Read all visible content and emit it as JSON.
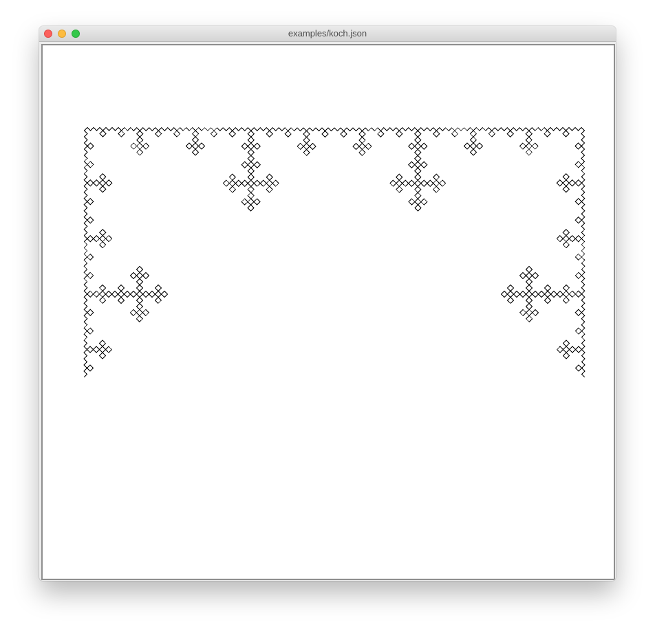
{
  "window": {
    "title": "examples/koch.json",
    "buttons": {
      "close": "close-button",
      "minimize": "minimize-button",
      "zoom": "zoom-button"
    }
  },
  "canvas": {
    "background": "#ffffff",
    "stroke": "#000000",
    "figure": "quadratic-koch-triangle"
  }
}
